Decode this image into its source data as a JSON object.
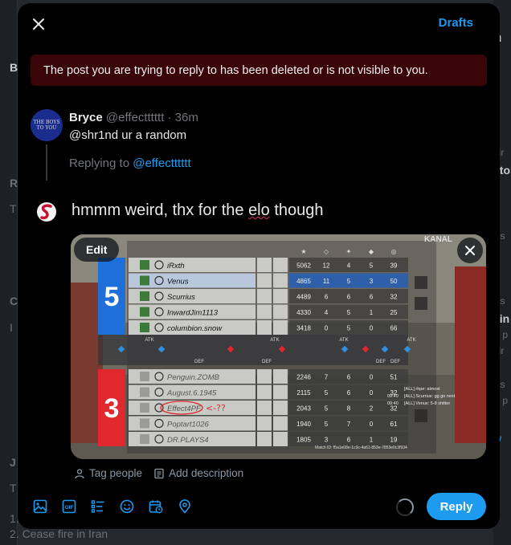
{
  "modal": {
    "drafts_label": "Drafts",
    "alert_text": "The post you are trying to reply to has been deleted or is not visible to you."
  },
  "original_post": {
    "author_name": "Bryce",
    "author_meta": "@effectttttt · 36m",
    "text": "@shr1nd ur a random",
    "replying_prefix": "Replying to ",
    "replying_handle": "@effectttttt",
    "avatar_text": "THE BOYS TO YOU"
  },
  "compose": {
    "text_before": "hmmm weird, thx for the ",
    "misspelled_word": "elo",
    "text_after": " though"
  },
  "media": {
    "edit_label": "Edit",
    "tag_people_label": "Tag people",
    "add_description_label": "Add description",
    "scoreboard": {
      "header_label": "KANAL",
      "team_top": {
        "score": "5",
        "color": "#1e6fd9",
        "players": [
          {
            "name": "iRxth",
            "stats": [
              "5062",
              "12",
              "4",
              "5",
              "39"
            ]
          },
          {
            "name": "Venus",
            "stats": [
              "4865",
              "11",
              "5",
              "3",
              "50"
            ]
          },
          {
            "name": "Scurrius",
            "stats": [
              "4489",
              "6",
              "6",
              "6",
              "32"
            ]
          },
          {
            "name": "InwardJim1113",
            "stats": [
              "4330",
              "4",
              "5",
              "1",
              "25"
            ]
          },
          {
            "name": "columbion.snow",
            "stats": [
              "3418",
              "0",
              "5",
              "0",
              "66"
            ]
          }
        ]
      },
      "team_bottom": {
        "score": "3",
        "color": "#e0282e",
        "players": [
          {
            "name": "Penguin.ZOMB",
            "stats": [
              "2246",
              "7",
              "6",
              "0",
              "51"
            ]
          },
          {
            "name": "August.6.1945",
            "stats": [
              "2115",
              "5",
              "6",
              "0",
              "32"
            ]
          },
          {
            "name": "Effect4PF",
            "stats": [
              "2043",
              "5",
              "8",
              "2",
              "32"
            ]
          },
          {
            "name": "Poptart1026",
            "stats": [
              "1940",
              "5",
              "7",
              "0",
              "61"
            ]
          },
          {
            "name": "DR.PLAYS4",
            "stats": [
              "1805",
              "3",
              "6",
              "1",
              "19"
            ]
          }
        ]
      },
      "annotation": "<-??",
      "atk_label": "ATK",
      "def_label": "DEF",
      "chat": [
        {
          "time": "",
          "text": "[ALL] rhpe: almost"
        },
        {
          "time": "09:40",
          "text": "[ALL] Scurrius: gg go next"
        },
        {
          "time": "09:40",
          "text": "[ALL] Venus: 5-8 shitter"
        }
      ],
      "match_id": "Match ID: f5a1e08e-1c3c-4a61-853e-7853e0c3f934"
    }
  },
  "toolbar": {
    "icons": [
      "image-icon",
      "gif-icon",
      "poll-icon",
      "emoji-icon",
      "schedule-icon",
      "location-icon"
    ],
    "reply_label": "Reply"
  },
  "background": {
    "left_letters": [
      "B",
      "R",
      "T",
      "C",
      "I",
      "J",
      "T",
      "1."
    ],
    "right_letters": [
      "n",
      "dir",
      "sto",
      "ics",
      "P",
      "ics",
      "vin",
      "K p",
      "dir",
      "ics",
      "K p",
      "w"
    ],
    "bottom_text": "2. Cease fire in Iran"
  },
  "colors": {
    "accent": "#1d9bf0",
    "alert_bg": "#3a0508",
    "modal_bg": "#000000"
  }
}
